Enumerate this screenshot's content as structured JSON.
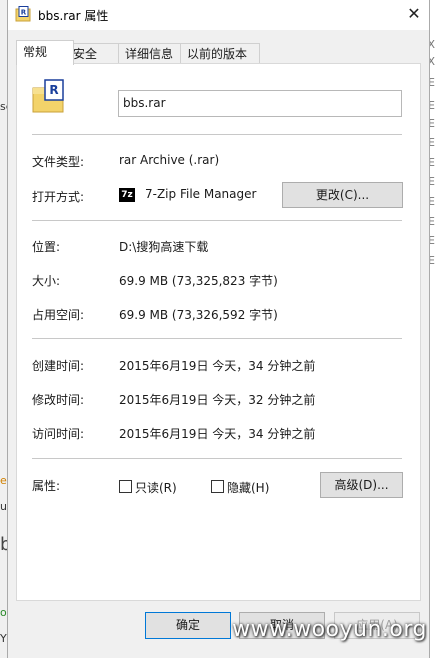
{
  "background": {
    "right_fragments": [
      "X",
      "X",
      "E",
      "E",
      "E",
      "E",
      "E",
      "E",
      "E",
      "E",
      "E",
      "E"
    ],
    "left_fragments": [
      "se",
      "e",
      "u.",
      "b",
      "o",
      "Yz"
    ]
  },
  "window": {
    "title": "bbs.rar 属性",
    "close_icon": "close-icon"
  },
  "tabs": [
    {
      "label": "常规",
      "active": true
    },
    {
      "label": "安全",
      "active": false
    },
    {
      "label": "详细信息",
      "active": false
    },
    {
      "label": "以前的版本",
      "active": false
    }
  ],
  "general": {
    "file_name": "bbs.rar",
    "file_type_label": "文件类型:",
    "file_type_value": "rar Archive (.rar)",
    "open_with_label": "打开方式:",
    "open_with_value": "7-Zip File Manager",
    "open_with_icon_text": "7z",
    "change_button": "更改(C)...",
    "location_label": "位置:",
    "location_value": "D:\\搜狗高速下载",
    "size_label": "大小:",
    "size_value": "69.9 MB (73,325,823 字节)",
    "size_on_disk_label": "占用空间:",
    "size_on_disk_value": "69.9 MB (73,326,592 字节)",
    "created_label": "创建时间:",
    "created_value": "2015年6月19日 今天，34 分钟之前",
    "modified_label": "修改时间:",
    "modified_value": "2015年6月19日 今天，32 分钟之前",
    "accessed_label": "访问时间:",
    "accessed_value": "2015年6月19日 今天，34 分钟之前",
    "attributes_label": "属性:",
    "readonly_label": "只读(R)",
    "hidden_label": "隐藏(H)",
    "advanced_button": "高级(D)..."
  },
  "footer": {
    "ok_button": "确定",
    "cancel_button": "取消",
    "apply_button": "应用(A)"
  },
  "watermark": "www.wooyun.org",
  "colors": {
    "accent": "#0078d7",
    "folder_yellow": "#f3d36a"
  }
}
